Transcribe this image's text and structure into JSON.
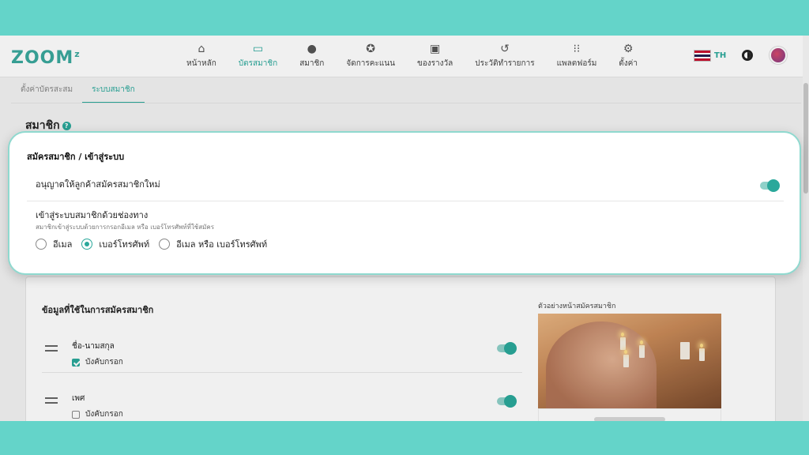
{
  "brand": {
    "logo_text": "ZOOM",
    "logo_sup": "z"
  },
  "nav": {
    "items": [
      {
        "label": "หน้าหลัก",
        "icon": "home-icon",
        "glyph": "⌂"
      },
      {
        "label": "บัตรสมาชิก",
        "icon": "card-icon",
        "glyph": "▭",
        "active": true
      },
      {
        "label": "สมาชิก",
        "icon": "person-icon",
        "glyph": "●"
      },
      {
        "label": "จัดการคะแนน",
        "icon": "star-icon",
        "glyph": "✪"
      },
      {
        "label": "ของรางวัล",
        "icon": "gift-icon",
        "glyph": "▣"
      },
      {
        "label": "ประวัติทำรายการ",
        "icon": "history-icon",
        "glyph": "↺"
      },
      {
        "label": "แพลตฟอร์ม",
        "icon": "grid-icon",
        "glyph": "⁝⁝"
      },
      {
        "label": "ตั้งค่า",
        "icon": "gear-icon",
        "glyph": "⚙"
      }
    ],
    "language": "TH"
  },
  "subtabs": {
    "items": [
      {
        "label": "ตั้งค่าบัตรสะสม",
        "active": false
      },
      {
        "label": "ระบบสมาชิก",
        "active": true
      }
    ]
  },
  "page": {
    "title": "สมาชิก",
    "help": "?"
  },
  "modal": {
    "title": "สมัครสมาชิก / เข้าสู่ระบบ",
    "allow_signup_label": "อนุญาตให้ลูกค้าสมัครสมาชิกใหม่",
    "allow_signup_on": true,
    "login_channel_label": "เข้าสู่ระบบสมาชิกด้วยช่องทาง",
    "login_channel_desc": "สมาชิกเข้าสู่ระบบด้วยการกรอกอีเมล หรือ เบอร์โทรศัพท์ที่ใช้สมัคร",
    "options": [
      {
        "label": "อีเมล",
        "selected": false
      },
      {
        "label": "เบอร์โทรศัพท์",
        "selected": true
      },
      {
        "label": "อีเมล หรือ เบอร์โทรศัพท์",
        "selected": false
      }
    ]
  },
  "signup_fields": {
    "section_label": "ข้อมูลที่ใช้ในการสมัครสมาชิก",
    "required_label": "บังคับกรอก",
    "fields": [
      {
        "name": "ชื่อ-นามสกุล",
        "required": true,
        "enabled": true
      },
      {
        "name": "เพศ",
        "required": false,
        "enabled": true
      }
    ],
    "preview_label": "ตัวอย่างหน้าสมัครสมาชิก"
  },
  "colors": {
    "accent": "#2aa89b",
    "frame": "#64d4c9"
  }
}
